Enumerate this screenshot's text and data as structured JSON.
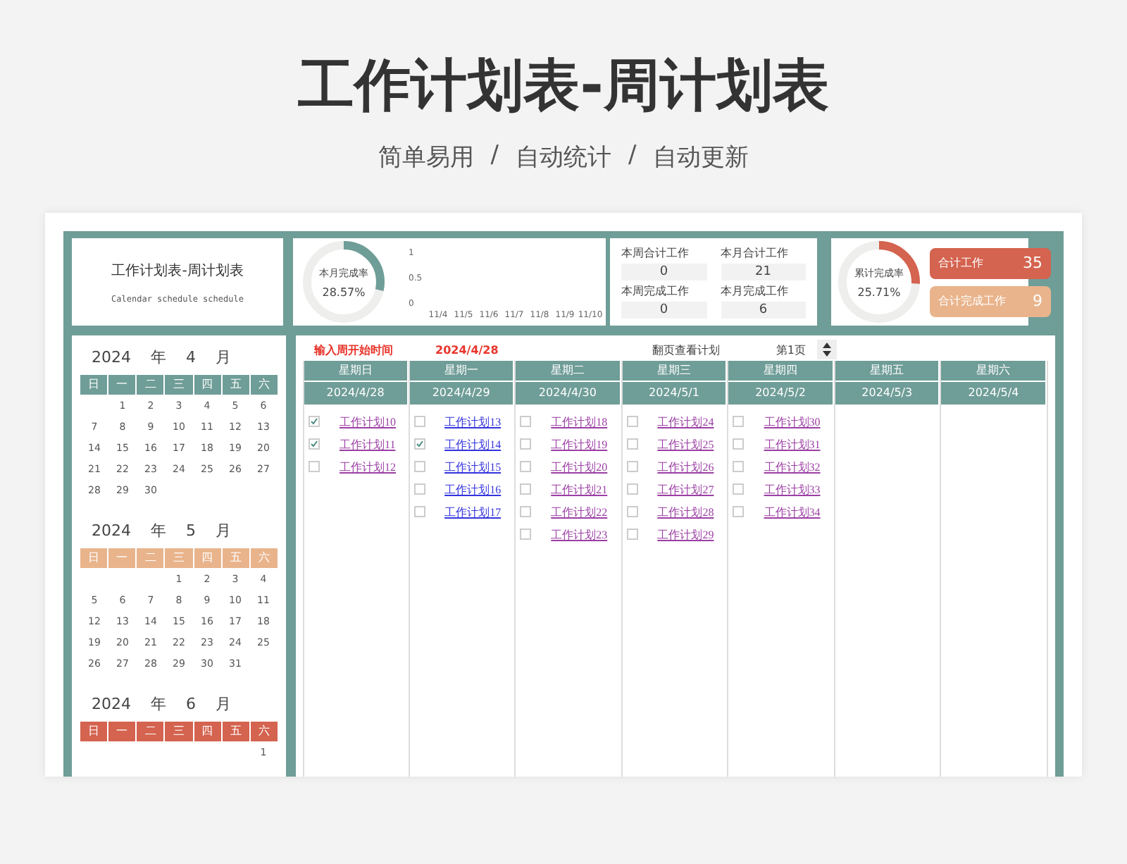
{
  "title": "工作计划表-周计划表",
  "subtitle": [
    "简单易用",
    "/",
    "自动统计",
    "/",
    "自动更新"
  ],
  "header_panel": {
    "title": "工作计划表-周计划表",
    "subtitle": "Calendar schedule schedule"
  },
  "month_rate": {
    "label": "本月完成率",
    "value": "28.57%",
    "level": 0.2857
  },
  "chart_data": {
    "type": "bar",
    "categories": [
      "11/4",
      "11/5",
      "11/6",
      "11/7",
      "11/8",
      "11/9",
      "11/10"
    ],
    "values": [
      0,
      0,
      0,
      0,
      0,
      0,
      0
    ],
    "ylim": [
      0,
      1
    ],
    "yticks": [
      0,
      0.5,
      1
    ]
  },
  "stats": [
    {
      "label": "本周合计工作",
      "value": "0"
    },
    {
      "label": "本月合计工作",
      "value": "21"
    },
    {
      "label": "本周完成工作",
      "value": "0"
    },
    {
      "label": "本月完成工作",
      "value": "6"
    }
  ],
  "total_rate": {
    "label": "累计完成率",
    "value": "25.71%",
    "level": 0.2571
  },
  "totals": [
    {
      "label": "合计工作",
      "value": "35",
      "color": "#d4634f"
    },
    {
      "label": "合计完成工作",
      "value": "9",
      "color": "#e9b48c"
    }
  ],
  "months": [
    {
      "year": "2024",
      "year_unit": "年",
      "month": "4",
      "month_unit": "月",
      "color": "#6f9d97",
      "weekdays": [
        "日",
        "一",
        "二",
        "三",
        "四",
        "五",
        "六"
      ],
      "weeks": [
        {
          "kind": "lead",
          "days": [
            "1",
            "2",
            "3",
            "4",
            "5",
            "6"
          ]
        },
        {
          "kind": "full",
          "days": [
            "7",
            "8",
            "9",
            "10",
            "11",
            "12",
            "13"
          ]
        },
        {
          "kind": "full",
          "days": [
            "14",
            "15",
            "16",
            "17",
            "18",
            "19",
            "20"
          ]
        },
        {
          "kind": "full",
          "days": [
            "21",
            "22",
            "23",
            "24",
            "25",
            "26",
            "27"
          ]
        },
        {
          "kind": "full",
          "days": [
            "28",
            "29",
            "30"
          ]
        }
      ]
    },
    {
      "year": "2024",
      "year_unit": "年",
      "month": "5",
      "month_unit": "月",
      "color": "#e9b48c",
      "weekdays": [
        "日",
        "一",
        "二",
        "三",
        "四",
        "五",
        "六"
      ],
      "weeks": [
        {
          "kind": "lead",
          "days": [
            "1",
            "2",
            "3",
            "4"
          ]
        },
        {
          "kind": "full",
          "days": [
            "5",
            "6",
            "7",
            "8",
            "9",
            "10",
            "11"
          ]
        },
        {
          "kind": "full",
          "days": [
            "12",
            "13",
            "14",
            "15",
            "16",
            "17",
            "18"
          ]
        },
        {
          "kind": "full",
          "days": [
            "19",
            "20",
            "21",
            "22",
            "23",
            "24",
            "25"
          ]
        },
        {
          "kind": "full",
          "days": [
            "26",
            "27",
            "28",
            "29",
            "30",
            "31"
          ]
        }
      ]
    },
    {
      "year": "2024",
      "year_unit": "年",
      "month": "6",
      "month_unit": "月",
      "color": "#d4634f",
      "weekdays": [
        "日",
        "一",
        "二",
        "三",
        "四",
        "五",
        "六"
      ],
      "weeks": [
        {
          "kind": "lead",
          "days": [
            "1"
          ]
        }
      ]
    }
  ],
  "week_start": {
    "label": "输入周开始时间",
    "value": "2024/4/28"
  },
  "pager": {
    "label": "翻页查看计划",
    "page": "第1页"
  },
  "days": [
    {
      "name": "星期日",
      "date": "2024/4/28",
      "tasks": [
        {
          "label": "工作计划10",
          "checked": true,
          "visited": true
        },
        {
          "label": "工作计划11",
          "checked": true,
          "visited": true
        },
        {
          "label": "工作计划12",
          "checked": false,
          "visited": true
        }
      ]
    },
    {
      "name": "星期一",
      "date": "2024/4/29",
      "tasks": [
        {
          "label": "工作计划13",
          "checked": false,
          "visited": false
        },
        {
          "label": "工作计划14",
          "checked": true,
          "visited": false
        },
        {
          "label": "工作计划15",
          "checked": false,
          "visited": false
        },
        {
          "label": "工作计划16",
          "checked": false,
          "visited": false
        },
        {
          "label": "工作计划17",
          "checked": false,
          "visited": false
        }
      ]
    },
    {
      "name": "星期二",
      "date": "2024/4/30",
      "tasks": [
        {
          "label": "工作计划18",
          "checked": false,
          "visited": true
        },
        {
          "label": "工作计划19",
          "checked": false,
          "visited": true
        },
        {
          "label": "工作计划20",
          "checked": false,
          "visited": true
        },
        {
          "label": "工作计划21",
          "checked": false,
          "visited": true
        },
        {
          "label": "工作计划22",
          "checked": false,
          "visited": true
        },
        {
          "label": "工作计划23",
          "checked": false,
          "visited": true
        }
      ]
    },
    {
      "name": "星期三",
      "date": "2024/5/1",
      "tasks": [
        {
          "label": "工作计划24",
          "checked": false,
          "visited": true
        },
        {
          "label": "工作计划25",
          "checked": false,
          "visited": true
        },
        {
          "label": "工作计划26",
          "checked": false,
          "visited": true
        },
        {
          "label": "工作计划27",
          "checked": false,
          "visited": true
        },
        {
          "label": "工作计划28",
          "checked": false,
          "visited": true
        },
        {
          "label": "工作计划29",
          "checked": false,
          "visited": true
        }
      ]
    },
    {
      "name": "星期四",
      "date": "2024/5/2",
      "tasks": [
        {
          "label": "工作计划30",
          "checked": false,
          "visited": true
        },
        {
          "label": "工作计划31",
          "checked": false,
          "visited": true
        },
        {
          "label": "工作计划32",
          "checked": false,
          "visited": true
        },
        {
          "label": "工作计划33",
          "checked": false,
          "visited": true
        },
        {
          "label": "工作计划34",
          "checked": false,
          "visited": true
        }
      ]
    },
    {
      "name": "星期五",
      "date": "2024/5/3"
    },
    {
      "name": "星期六",
      "date": "2024/5/4"
    }
  ]
}
